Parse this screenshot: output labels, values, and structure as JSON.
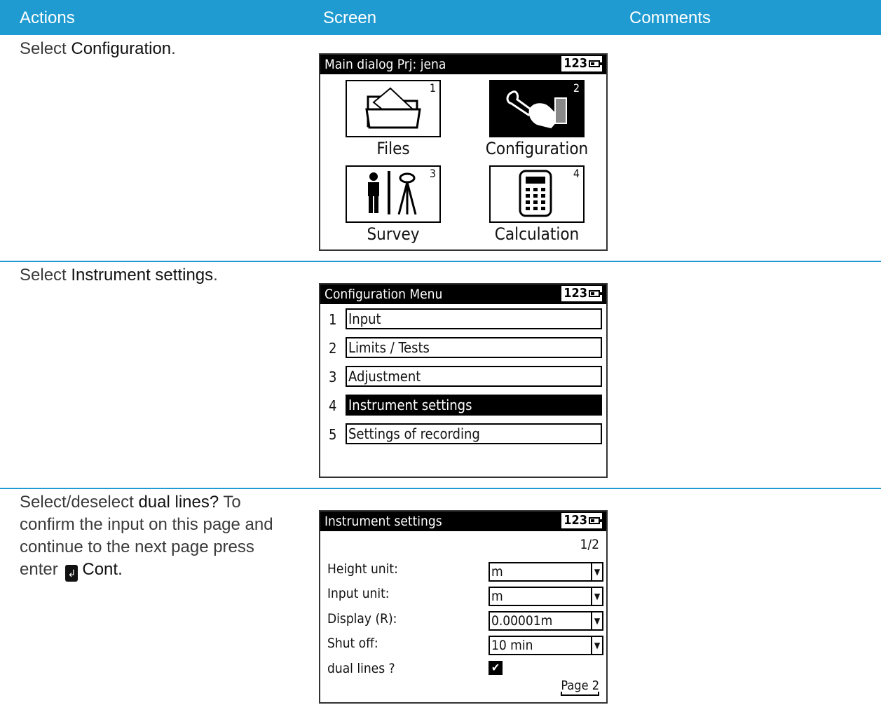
{
  "header": {
    "col_actions": "Actions",
    "col_screen": "Screen",
    "col_comments": "Comments"
  },
  "rows": [
    {
      "action_prefix": "Select ",
      "action_bold": "Configuration",
      "action_suffix": "."
    },
    {
      "action_prefix": "Select ",
      "action_bold": "Instrument settings",
      "action_suffix": "."
    },
    {
      "action_prefix": "Select/deselect ",
      "action_bold": "dual lines?",
      "action_mid": " To confirm the input on this page and continue to the next page press enter ",
      "action_key": "↲",
      "action_bold2": "Cont."
    }
  ],
  "screen1": {
    "title": "Main dialog  Prj: jena",
    "status": "123",
    "tiles": [
      {
        "label": "Files",
        "num": "1",
        "icon": "folder-icon"
      },
      {
        "label": "Configuration",
        "num": "2",
        "icon": "wrench-hand-icon"
      },
      {
        "label": "Survey",
        "num": "3",
        "icon": "surveyor-tripod-icon"
      },
      {
        "label": "Calculation",
        "num": "4",
        "icon": "calculator-icon"
      }
    ]
  },
  "screen2": {
    "title": "Configuration Menu",
    "status": "123",
    "items": [
      {
        "num": "1",
        "label": "Input"
      },
      {
        "num": "2",
        "label": "Limits / Tests"
      },
      {
        "num": "3",
        "label": "Adjustment"
      },
      {
        "num": "4",
        "label": "Instrument settings"
      },
      {
        "num": "5",
        "label": "Settings of recording"
      }
    ]
  },
  "screen3": {
    "title": "Instrument settings",
    "status": "123",
    "page_indicator": "1/2",
    "settings": [
      {
        "label": "Height unit:",
        "value": "m"
      },
      {
        "label": "Input unit:",
        "value": "m"
      },
      {
        "label": "Display (R):",
        "value": "0.00001m"
      },
      {
        "label": "Shut off:",
        "value": "10 min"
      }
    ],
    "dual_lines_label": "dual lines ?",
    "dual_lines_checked": true,
    "softkey": "Page 2"
  }
}
